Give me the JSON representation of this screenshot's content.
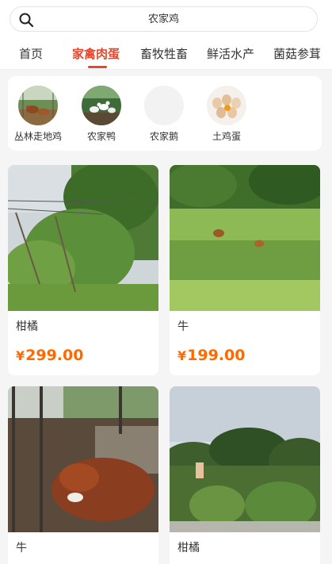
{
  "search": {
    "text": "农家鸡",
    "icon": "search-icon"
  },
  "tabs": [
    {
      "label": "首页",
      "active": false
    },
    {
      "label": "家禽肉蛋",
      "active": true
    },
    {
      "label": "畜牧牲畜",
      "active": false
    },
    {
      "label": "鲜活水产",
      "active": false
    },
    {
      "label": "菌菇参茸",
      "active": false
    }
  ],
  "subcategories": [
    {
      "label": "丛林走地鸡"
    },
    {
      "label": "农家鸭"
    },
    {
      "label": "农家鹅"
    },
    {
      "label": "土鸡蛋"
    }
  ],
  "products": [
    {
      "title": "柑橘",
      "currency": "¥",
      "price": "299.00"
    },
    {
      "title": "牛",
      "currency": "¥",
      "price": "199.00"
    },
    {
      "title": "牛"
    },
    {
      "title": "柑橘"
    }
  ],
  "colors": {
    "accent": "#e8452b",
    "price": "#ff6a00",
    "background": "#f5f5f5"
  }
}
